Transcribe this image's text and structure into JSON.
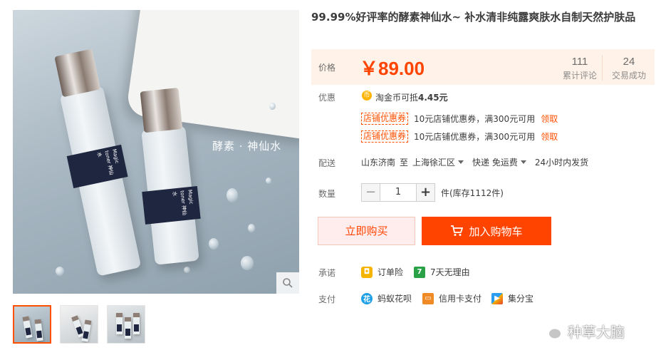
{
  "product": {
    "title": "99.99%好评率的酵素神仙水~ 补水清非纯露爽肤水自制天然护肤品",
    "photo_watermark": "酵素 · 神仙水",
    "bottle_label_1": "Magic toner 神仙水",
    "bottle_label_2": "Magic toner 神仙水"
  },
  "price": {
    "label": "价格",
    "value": "￥89.00",
    "reviews_count": "111",
    "reviews_label": "累计评论",
    "sales_count": "24",
    "sales_label": "交易成功"
  },
  "promo": {
    "label": "优惠",
    "coin_icon": "taojinbi-coin-icon",
    "coin_text_prefix": "淘金币可抵",
    "coin_amount": "4.45元",
    "coupons": [
      {
        "tag": "店铺优惠券",
        "desc": "10元店铺优惠券，满300元可用",
        "action": "领取"
      },
      {
        "tag": "店铺优惠券",
        "desc": "10元店铺优惠券，满300元可用",
        "action": "领取"
      }
    ]
  },
  "shipping": {
    "label": "配送",
    "from": "山东济南",
    "to_word": "至",
    "to": "上海徐汇区",
    "method": "快递 免运费",
    "dispatch": "24小时内发货"
  },
  "quantity": {
    "label": "数量",
    "minus": "−",
    "value": "1",
    "plus": "+",
    "stock": "件(库存1112件)"
  },
  "actions": {
    "buy_now": "立即购买",
    "add_to_cart": "加入购物车"
  },
  "promise": {
    "label": "承诺",
    "items": [
      "订单险",
      "7天无理由"
    ]
  },
  "payment": {
    "label": "支付",
    "items": [
      "蚂蚁花呗",
      "信用卡支付",
      "集分宝"
    ]
  },
  "watermark": {
    "text": "种草大脑"
  },
  "colors": {
    "accent": "#ff4400",
    "price_bg": "#fff2e8"
  }
}
